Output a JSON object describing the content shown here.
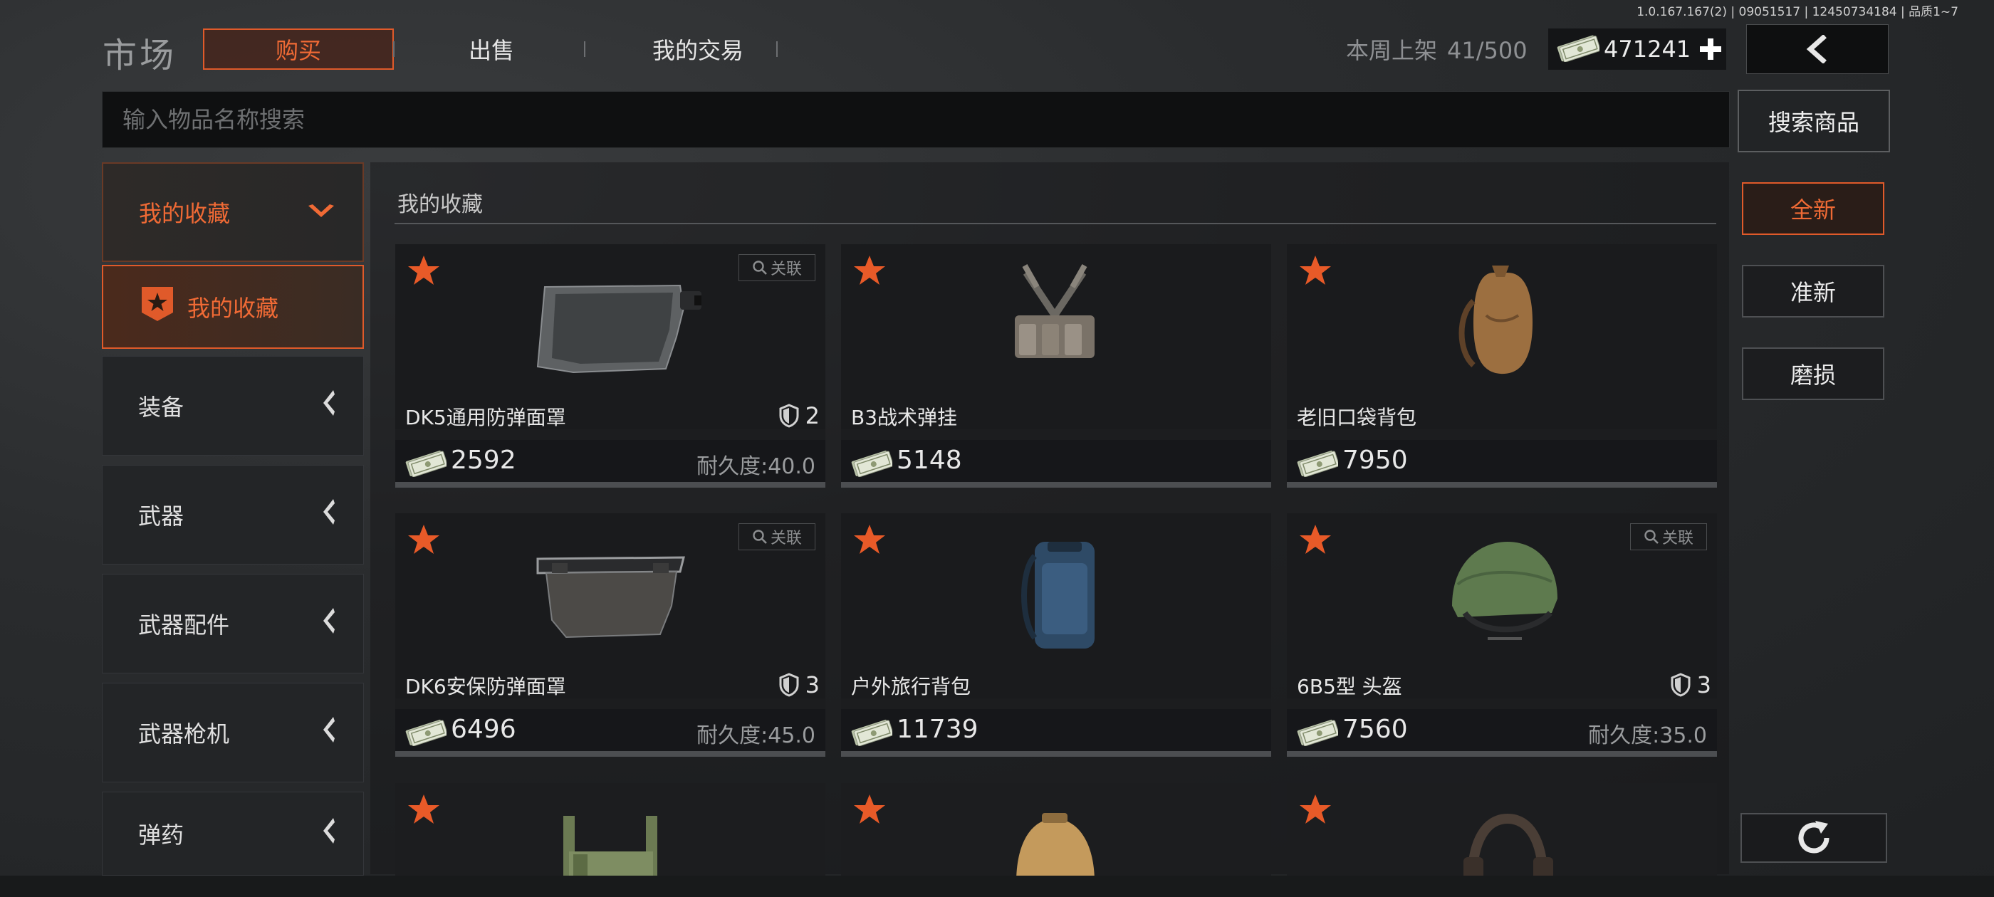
{
  "version_text": "1.0.167.167(2) | 09051517 | 12450734184 | 品质1~7",
  "header": {
    "title": "市场",
    "tabs": [
      {
        "label": "购买",
        "active": true
      },
      {
        "label": "出售",
        "active": false
      },
      {
        "label": "我的交易",
        "active": false
      }
    ],
    "weekly_label": "本周上架",
    "weekly_count": "41/500",
    "money": "471241",
    "icons": {
      "money": "cash-icon",
      "add": "plus-icon",
      "back": "back-chevron-icon"
    }
  },
  "search": {
    "placeholder": "输入物品名称搜索",
    "button_label": "搜索商品"
  },
  "sidebar": {
    "header_label": "我的收藏",
    "active_item_label": "我的收藏",
    "items": [
      {
        "label": "装备"
      },
      {
        "label": "武器"
      },
      {
        "label": "武器配件"
      },
      {
        "label": "武器枪机"
      },
      {
        "label": "弹药"
      }
    ]
  },
  "main": {
    "section_title": "我的收藏",
    "related_label": "关联",
    "durability_label": "耐久度:",
    "items": [
      {
        "name": "DK5通用防弹面罩",
        "price": "2592",
        "armor": "2",
        "durability": "40.0",
        "related": true,
        "icon": "visor-icon"
      },
      {
        "name": "B3战术弹挂",
        "price": "5148",
        "armor": "",
        "durability": "",
        "related": false,
        "icon": "chest-rig-icon"
      },
      {
        "name": "老旧口袋背包",
        "price": "7950",
        "armor": "",
        "durability": "",
        "related": false,
        "icon": "sack-backpack-icon"
      },
      {
        "name": "DK6安保防弹面罩",
        "price": "6496",
        "armor": "3",
        "durability": "45.0",
        "related": true,
        "icon": "visor-icon"
      },
      {
        "name": "户外旅行背包",
        "price": "11739",
        "armor": "",
        "durability": "",
        "related": false,
        "icon": "travel-backpack-icon"
      },
      {
        "name": "6B5型 头盔",
        "price": "7560",
        "armor": "3",
        "durability": "35.0",
        "related": true,
        "icon": "helmet-icon"
      }
    ],
    "partial_row_icons": [
      "camo-rig-icon",
      "tan-backpack-icon",
      "headset-icon"
    ]
  },
  "filters": [
    {
      "label": "全新",
      "active": true
    },
    {
      "label": "准新",
      "active": false
    },
    {
      "label": "磨损",
      "active": false
    }
  ],
  "colors": {
    "accent": "#f06a35",
    "accent_border": "#e05a2a",
    "background": "#2a2c2e",
    "card": "#1c1d1f"
  }
}
